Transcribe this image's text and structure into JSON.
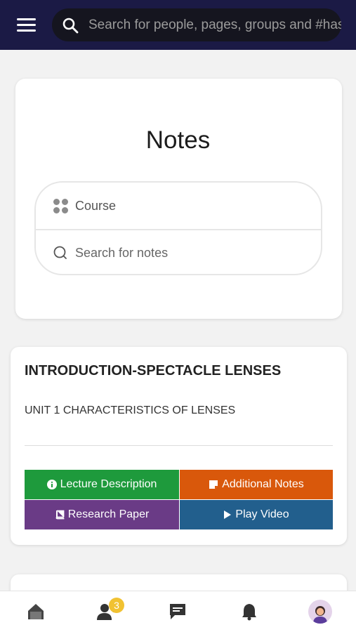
{
  "topbar": {
    "search_placeholder": "Search for people, pages, groups and #hashtags"
  },
  "notes": {
    "title": "Notes",
    "course_label": "Course",
    "search_placeholder": "Search for notes"
  },
  "lecture": {
    "title": "INTRODUCTION-SPECTACLE LENSES",
    "subtitle": "UNIT 1 CHARACTERISTICS OF LENSES",
    "buttons": [
      {
        "label": "Lecture Description",
        "color": "#1e9a3c"
      },
      {
        "label": "Additional Notes",
        "color": "#d9580b"
      },
      {
        "label": "Research Paper",
        "color": "#6a3b86"
      },
      {
        "label": "Play Video",
        "color": "#225f8d"
      }
    ]
  },
  "bottom_nav": {
    "friends_badge": "3"
  },
  "colors": {
    "topbar_bg": "#1b1a45",
    "badge": "#f1c232"
  }
}
